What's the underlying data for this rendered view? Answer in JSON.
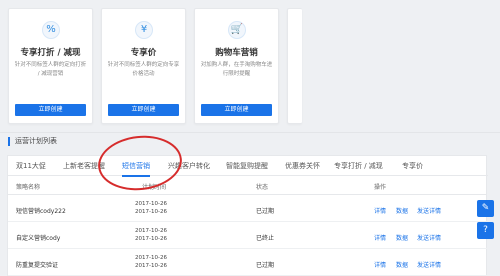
{
  "cards": [
    {
      "icon": "percent-icon",
      "glyph": "%",
      "title": "专享打折 / 减现",
      "desc": "针对不同标签人群的定向打折 / 减现营销",
      "button": "立即创建"
    },
    {
      "icon": "yen-icon",
      "glyph": "¥",
      "title": "专享价",
      "desc": "针对不同标签人群的定向专享价格活动",
      "button": "立即创建"
    },
    {
      "icon": "cart-icon",
      "glyph": "🛒",
      "title": "购物车营销",
      "desc": "对加购人群，在手淘购物车进行限时提醒",
      "button": "立即创建"
    }
  ],
  "section_title": "运营计划列表",
  "tabs": [
    "双11大促",
    "上新老客提醒",
    "短信营销",
    "兴趣客户转化",
    "智能复购提醒",
    "优惠券关怀",
    "专享打折 / 减现",
    "专享价"
  ],
  "active_tab": "短信营销",
  "table": {
    "headers": [
      "策略名称",
      "计划时间",
      "状态",
      "操作"
    ],
    "rows": [
      {
        "name": "短信营销cody222",
        "time1": "2017-10-26",
        "time2": "2017-10-26",
        "status": "已过期",
        "actions": [
          "详情",
          "数据",
          "发送详情"
        ]
      },
      {
        "name": "自定义营销cody",
        "time1": "2017-10-26",
        "time2": "2017-10-26",
        "status": "已终止",
        "actions": [
          "详情",
          "数据",
          "发送详情"
        ]
      },
      {
        "name": "防重复提交验证",
        "time1": "2017-10-26",
        "time2": "2017-10-26",
        "status": "已过期",
        "actions": [
          "详情",
          "数据",
          "发送详情"
        ]
      }
    ]
  },
  "floating": [
    "edit-icon",
    "help-icon"
  ],
  "colors": {
    "accent": "#1a73e8",
    "annotation": "#d62c2c"
  }
}
